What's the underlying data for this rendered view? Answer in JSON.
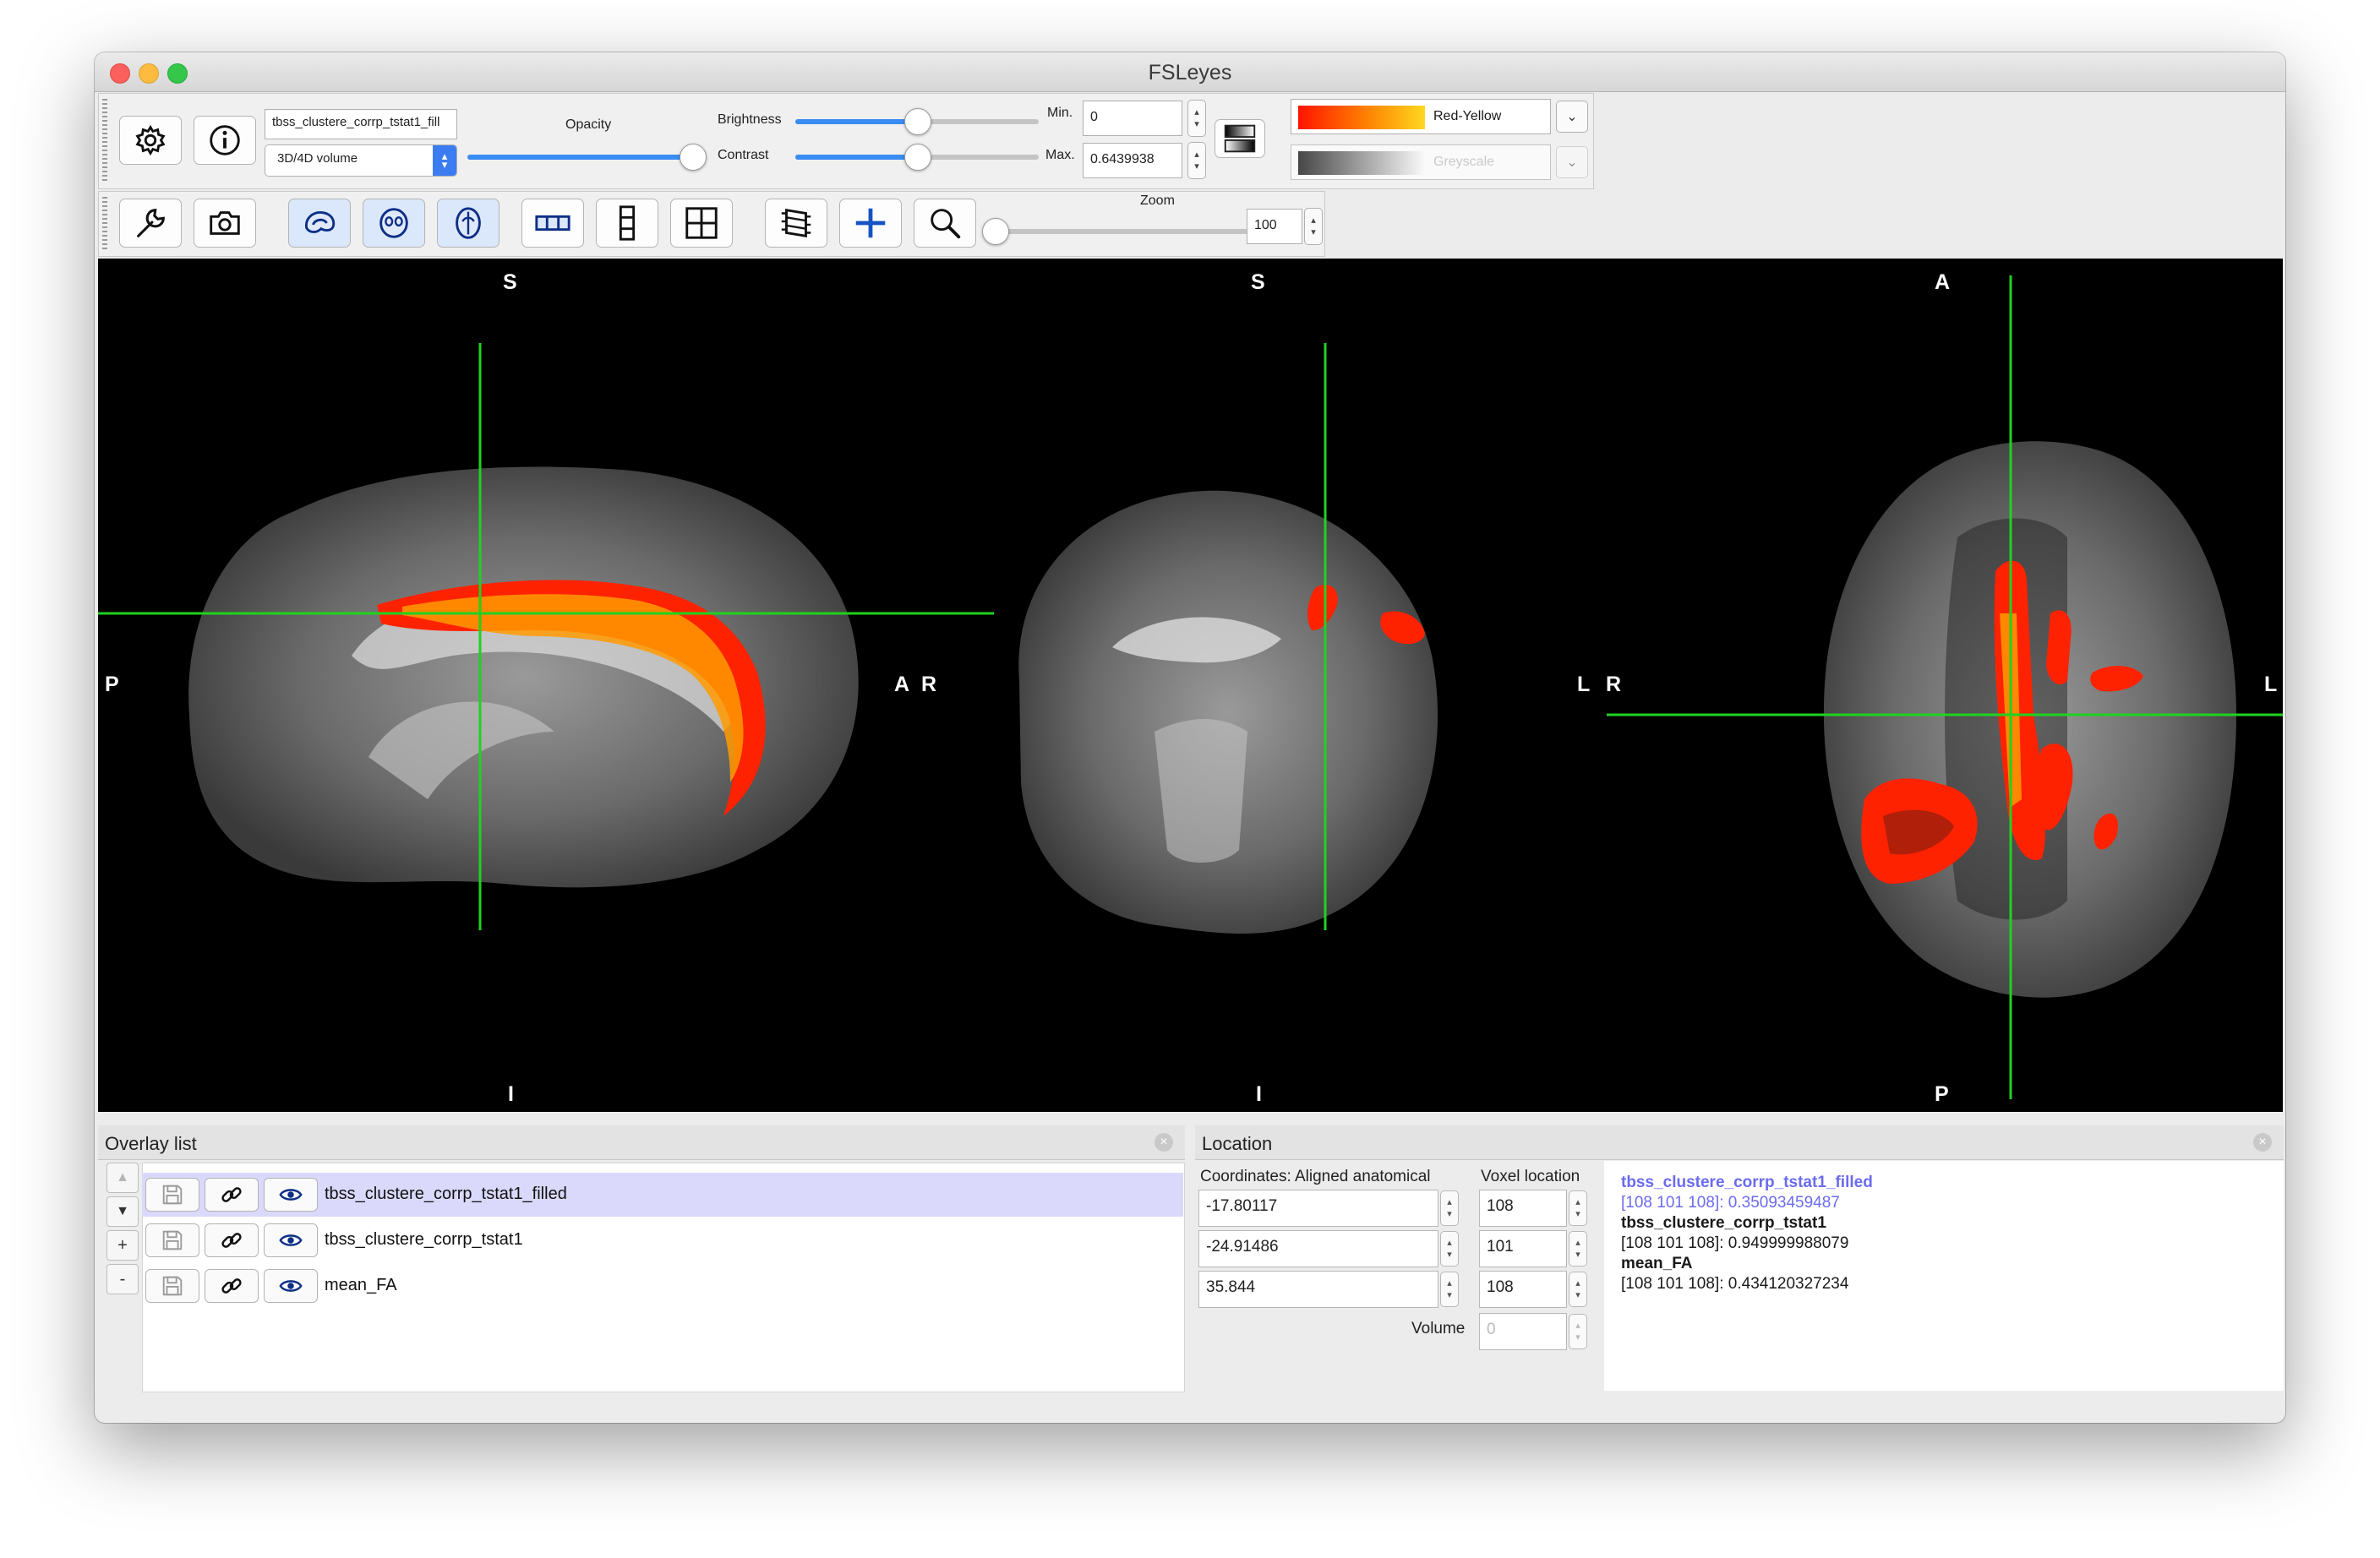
{
  "window": {
    "title": "FSLeyes"
  },
  "overlay_toolbar": {
    "overlay_name": "tbss_clustere_corrp_tstat1_fill",
    "volume_type": "3D/4D volume",
    "opacity_label": "Opacity",
    "opacity": 0.95,
    "brightness_label": "Brightness",
    "brightness": 0.5,
    "contrast_label": "Contrast",
    "contrast": 0.5,
    "min_label": "Min.",
    "min_value": "0",
    "max_label": "Max.",
    "max_value": "0.6439938",
    "colormap": "Red-Yellow",
    "colormap_neg": "Greyscale"
  },
  "ortho_toolbar": {
    "zoom_label": "Zoom",
    "zoom_value": "100",
    "zoom": 0
  },
  "views": {
    "sagittal": {
      "top": "S",
      "bottom": "I",
      "left": "P",
      "right": "A"
    },
    "coronal": {
      "top": "S",
      "bottom": "I",
      "left": "R",
      "right": "L"
    },
    "axial": {
      "top": "A",
      "bottom": "P",
      "left": "R",
      "right": "L"
    }
  },
  "overlay_list": {
    "title": "Overlay list",
    "items": [
      {
        "name": "tbss_clustere_corrp_tstat1_filled",
        "selected": true
      },
      {
        "name": "tbss_clustere_corrp_tstat1",
        "selected": false
      },
      {
        "name": "mean_FA",
        "selected": false
      }
    ],
    "buttons": {
      "up": "▲",
      "down": "▼",
      "add": "+",
      "remove": "-"
    }
  },
  "location": {
    "title": "Location",
    "coords_label": "Coordinates: Aligned anatomical",
    "voxel_label": "Voxel location",
    "coords": [
      "-17.80117",
      "-24.91486",
      "35.844"
    ],
    "voxels": [
      "108",
      "101",
      "108"
    ],
    "volume_label": "Volume",
    "volume_value": "0",
    "info": [
      {
        "name": "tbss_clustere_corrp_tstat1_filled",
        "value": "[108 101 108]: 0.35093459487"
      },
      {
        "name": "tbss_clustere_corrp_tstat1",
        "value": "[108 101 108]: 0.949999988079"
      },
      {
        "name": "mean_FA",
        "value": "[108 101 108]: 0.434120327234"
      }
    ]
  },
  "colors": {
    "crosshair": "#1fd21f",
    "overlay_red": "#ff1e00",
    "overlay_yellow": "#ffd21e",
    "selected_row": "#dad9fb",
    "info_highlight": "#6b6bf0"
  }
}
